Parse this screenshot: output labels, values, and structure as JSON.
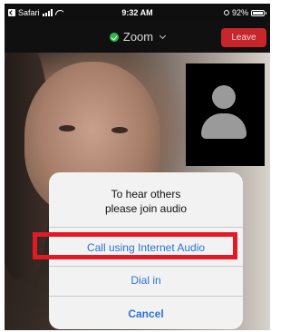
{
  "status_bar": {
    "back_app": "Safari",
    "time": "9:32 AM",
    "battery_percent": "92%"
  },
  "header": {
    "title": "Zoom",
    "leave_label": "Leave"
  },
  "audio_dialog": {
    "title_line1": "To hear others",
    "title_line2": "please join audio",
    "options": [
      {
        "label": "Call using Internet Audio"
      },
      {
        "label": "Dial in"
      }
    ],
    "cancel_label": "Cancel"
  },
  "colors": {
    "leave_button": "#c8262b",
    "link_blue": "#2b73d6",
    "highlight_red": "#e11a24",
    "secure_green": "#2fb84a"
  },
  "icons": {
    "status": [
      "back-icon",
      "signal-icon",
      "wifi-icon",
      "rotation-lock-icon",
      "battery-icon"
    ],
    "header": [
      "shield-check-icon",
      "chevron-down-icon"
    ],
    "self_view": "avatar-placeholder-icon"
  }
}
